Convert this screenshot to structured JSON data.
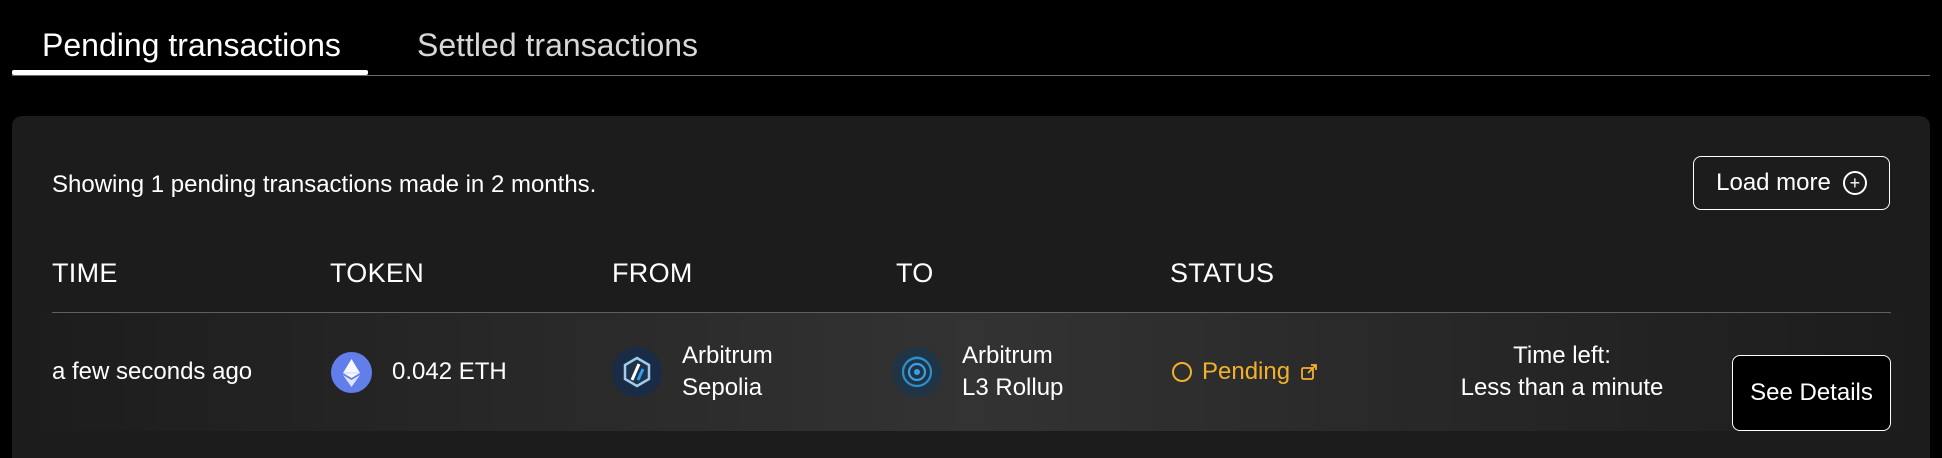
{
  "tabs": [
    {
      "label": "Pending transactions",
      "active": true
    },
    {
      "label": "Settled transactions",
      "active": false
    }
  ],
  "summary_text": "Showing 1 pending transactions made in 2 months.",
  "load_more_label": "Load more",
  "columns": [
    "TIME",
    "TOKEN",
    "FROM",
    "TO",
    "STATUS"
  ],
  "transaction": {
    "time": "a few seconds ago",
    "token": {
      "amount": "0.042 ETH",
      "icon": "ethereum-icon"
    },
    "from": {
      "line1": "Arbitrum",
      "line2": "Sepolia",
      "icon": "arbitrum-icon"
    },
    "to": {
      "line1": "Arbitrum",
      "line2": "L3 Rollup",
      "icon": "rollup-chain-icon"
    },
    "status": "Pending",
    "time_left_label": "Time left:",
    "time_left_value": "Less than a minute",
    "details_label": "See Details"
  },
  "colors": {
    "background": "#000000",
    "panel": "#1c1c1c",
    "pending": "#f3b02c",
    "eth": "#627eea"
  }
}
